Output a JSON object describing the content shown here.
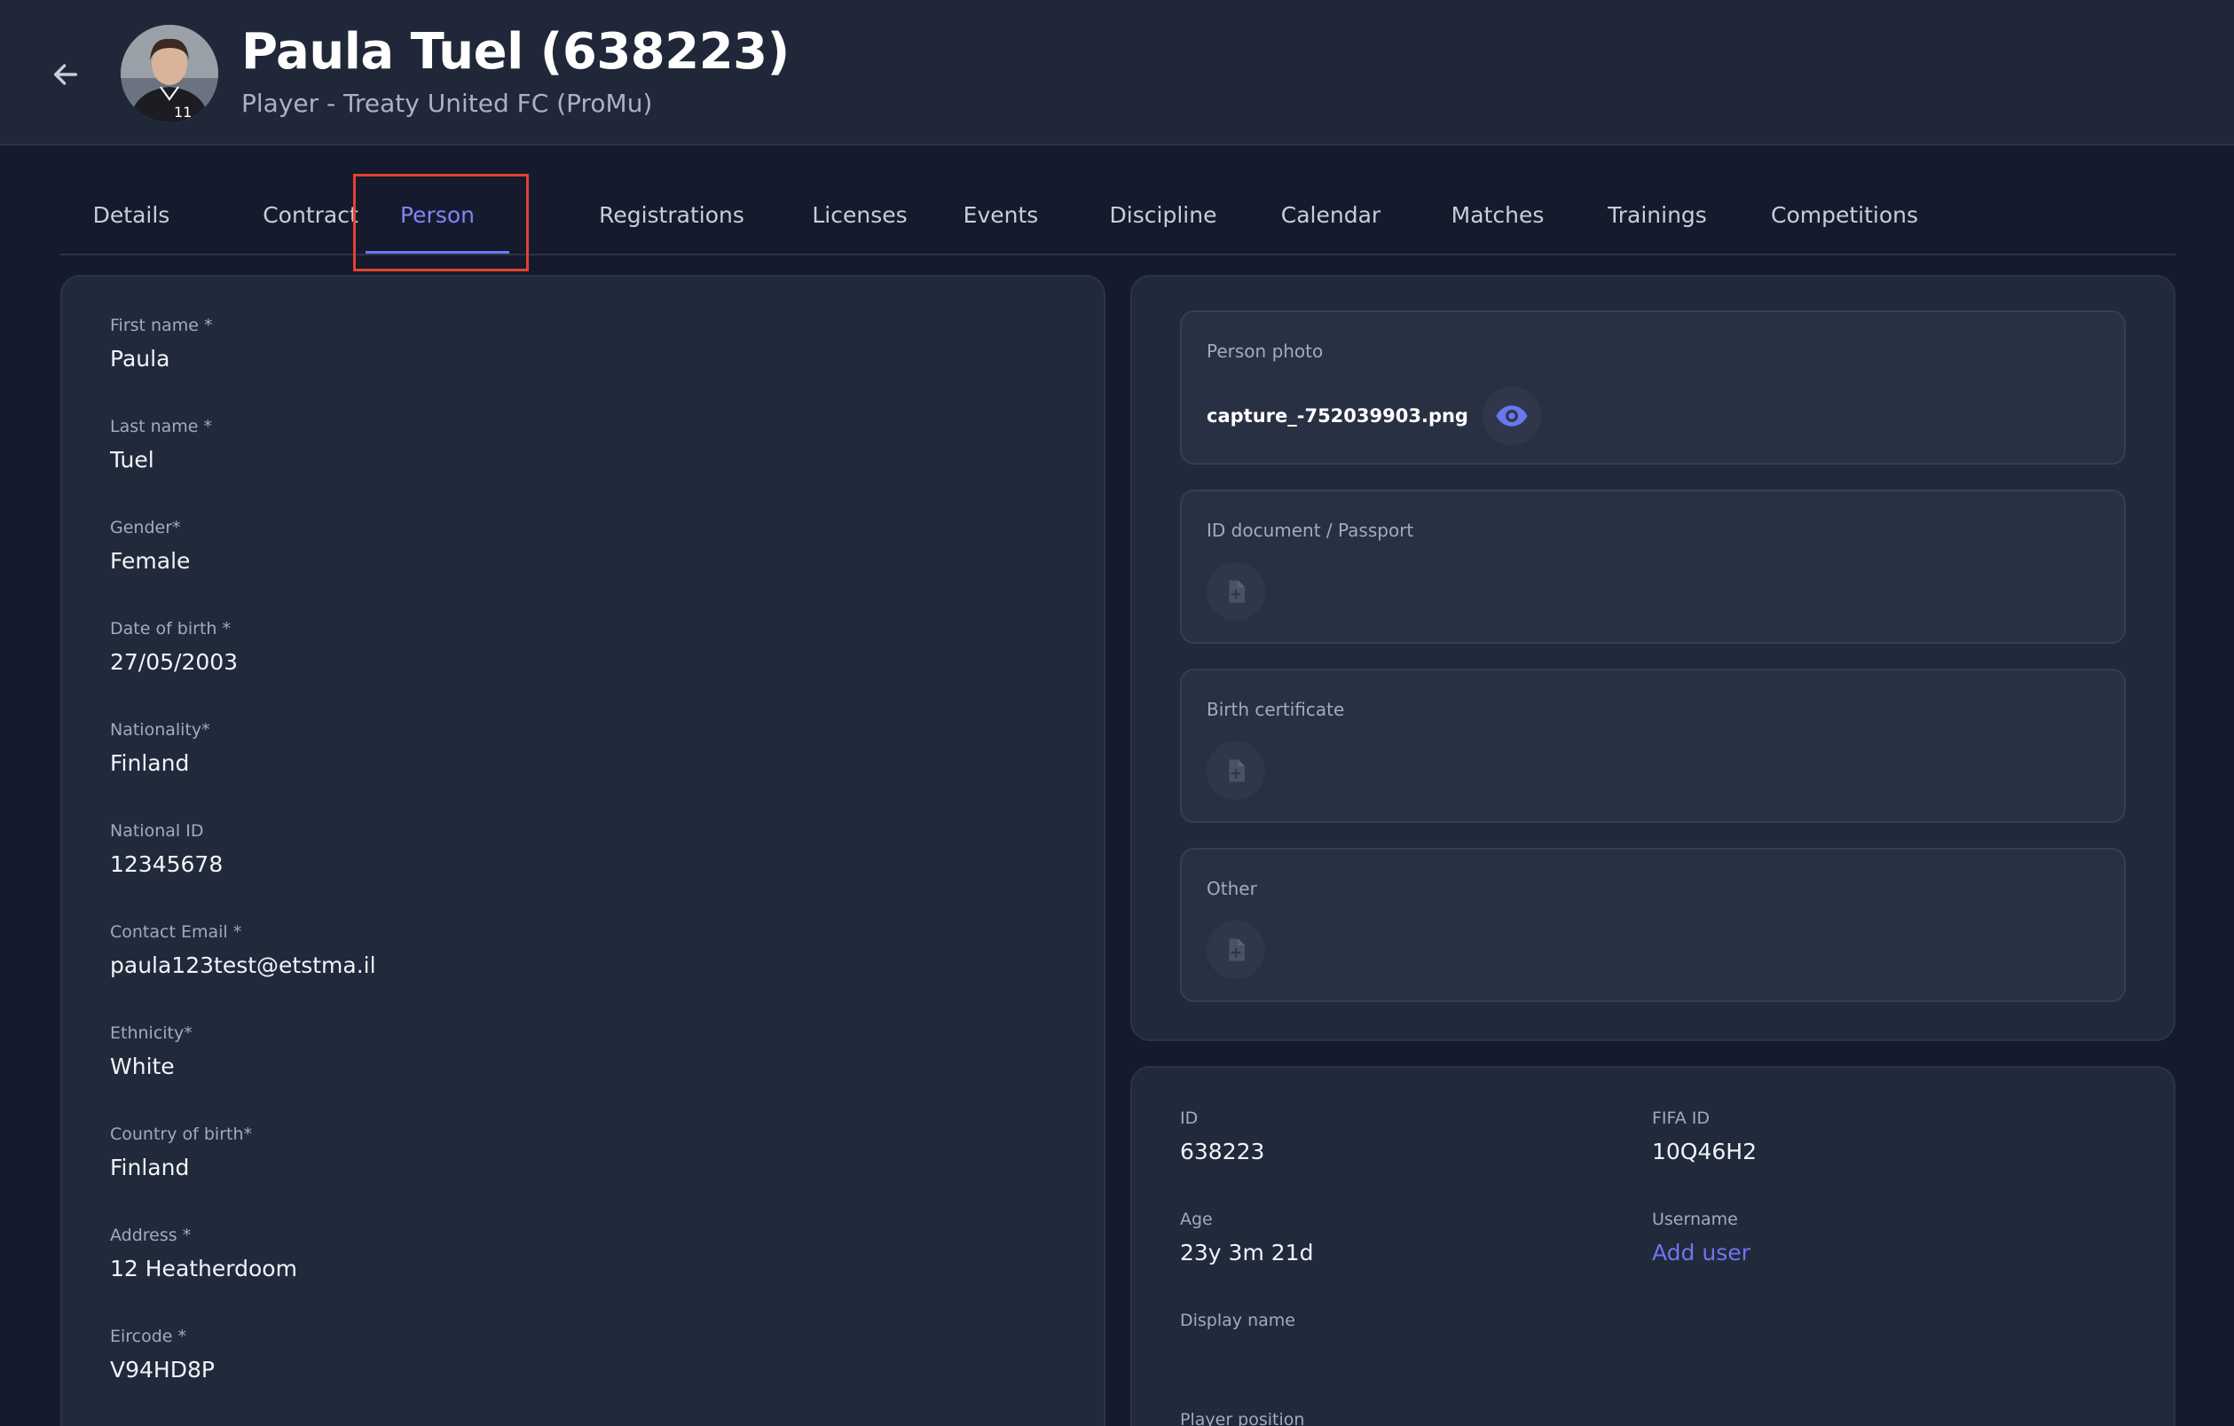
{
  "header": {
    "title": "Paula Tuel (638223)",
    "subtitle": "Player - Treaty United FC (ProMu)",
    "avatar_number": "11"
  },
  "tabs": [
    {
      "label": "Details"
    },
    {
      "label": "Contract"
    },
    {
      "label": "Person",
      "active": true
    },
    {
      "label": "Registrations"
    },
    {
      "label": "Licenses"
    },
    {
      "label": "Events"
    },
    {
      "label": "Discipline"
    },
    {
      "label": "Calendar"
    },
    {
      "label": "Matches"
    },
    {
      "label": "Trainings"
    },
    {
      "label": "Competitions"
    }
  ],
  "person_fields": [
    {
      "label": "First name *",
      "value": "Paula"
    },
    {
      "label": "Last name *",
      "value": "Tuel"
    },
    {
      "label": "Gender*",
      "value": "Female"
    },
    {
      "label": "Date of birth *",
      "value": "27/05/2003"
    },
    {
      "label": "Nationality*",
      "value": "Finland"
    },
    {
      "label": "National ID",
      "value": "12345678"
    },
    {
      "label": "Contact Email *",
      "value": "paula123test@etstma.il"
    },
    {
      "label": "Ethnicity*",
      "value": "White"
    },
    {
      "label": "Country of birth*",
      "value": "Finland"
    },
    {
      "label": "Address *",
      "value": "12 Heatherdoom"
    },
    {
      "label": "Eircode *",
      "value": "V94HD8P"
    }
  ],
  "documents": {
    "person_photo": {
      "label": "Person photo",
      "file": "capture_-752039903.png"
    },
    "id_document": {
      "label": "ID document / Passport"
    },
    "birth_certificate": {
      "label": "Birth certificate"
    },
    "other": {
      "label": "Other"
    }
  },
  "info": {
    "id": {
      "label": "ID",
      "value": "638223"
    },
    "fifa_id": {
      "label": "FIFA ID",
      "value": "10Q46H2"
    },
    "age": {
      "label": "Age",
      "value": "23y 3m 21d"
    },
    "username": {
      "label": "Username",
      "link": "Add user"
    },
    "display_name": {
      "label": "Display name"
    },
    "player_position": {
      "label": "Player position"
    }
  },
  "colors": {
    "background": "#151b2d",
    "card": "#212a3b",
    "accent": "#6d76f0",
    "highlight": "#e2422e"
  },
  "icons": {
    "back": "arrow-left-icon",
    "view": "eye-icon",
    "upload": "file-plus-icon"
  }
}
